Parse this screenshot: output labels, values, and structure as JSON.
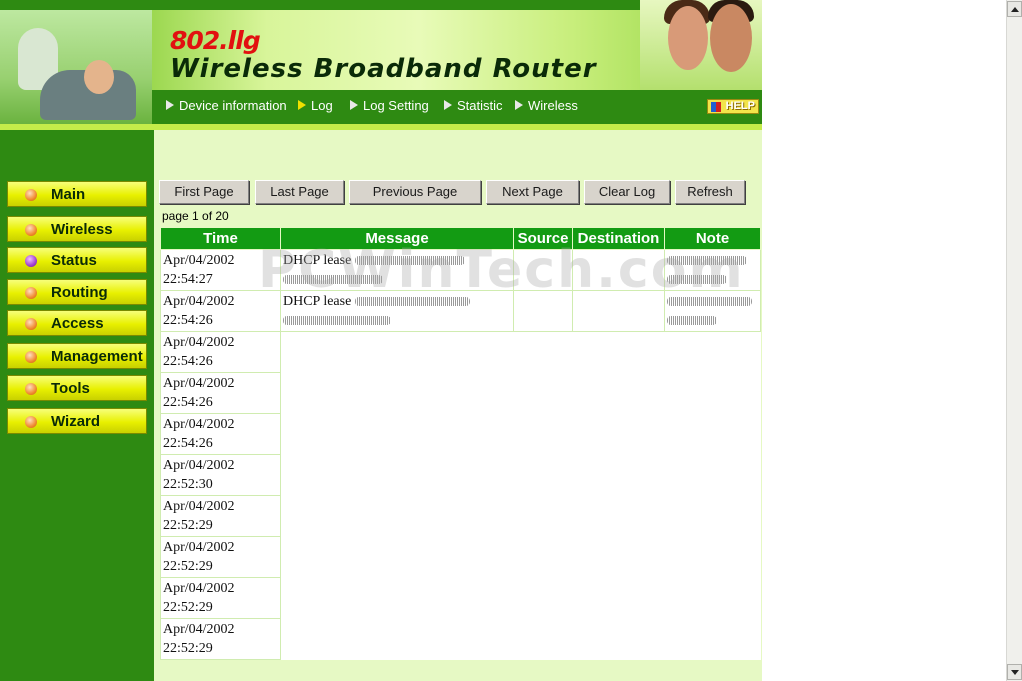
{
  "header": {
    "brand_small": "802.llg",
    "brand_big": "Wireless Broadband Router",
    "help_label": "HELP"
  },
  "topnav": {
    "items": [
      {
        "label": "Device information",
        "active": false
      },
      {
        "label": "Log",
        "active": true
      },
      {
        "label": "Log Setting",
        "active": false
      },
      {
        "label": "Statistic",
        "active": false
      },
      {
        "label": "Wireless",
        "active": false
      }
    ]
  },
  "sidebar": {
    "items": [
      {
        "label": "Main",
        "active": false
      },
      {
        "label": "Wireless",
        "active": false
      },
      {
        "label": "Status",
        "active": true
      },
      {
        "label": "Routing",
        "active": false
      },
      {
        "label": "Access",
        "active": false
      },
      {
        "label": "Management",
        "active": false
      },
      {
        "label": "Tools",
        "active": false
      },
      {
        "label": "Wizard",
        "active": false
      }
    ]
  },
  "toolbar": {
    "first_page": "First Page",
    "last_page": "Last Page",
    "previous_page": "Previous Page",
    "next_page": "Next Page",
    "clear_log": "Clear Log",
    "refresh": "Refresh"
  },
  "page_info": "page 1 of 20",
  "log_table": {
    "headers": [
      "Time",
      "Message",
      "Source",
      "Destination",
      "Note"
    ],
    "rows": [
      {
        "date": "Apr/04/2002",
        "time": "22:54:27",
        "message": "DHCP lease"
      },
      {
        "date": "Apr/04/2002",
        "time": "22:54:26",
        "message": "DHCP lease"
      },
      {
        "date": "Apr/04/2002",
        "time": "22:54:26",
        "message": ""
      },
      {
        "date": "Apr/04/2002",
        "time": "22:54:26",
        "message": ""
      },
      {
        "date": "Apr/04/2002",
        "time": "22:54:26",
        "message": ""
      },
      {
        "date": "Apr/04/2002",
        "time": "22:52:30",
        "message": ""
      },
      {
        "date": "Apr/04/2002",
        "time": "22:52:29",
        "message": ""
      },
      {
        "date": "Apr/04/2002",
        "time": "22:52:29",
        "message": ""
      },
      {
        "date": "Apr/04/2002",
        "time": "22:52:29",
        "message": ""
      },
      {
        "date": "Apr/04/2002",
        "time": "22:52:29",
        "message": ""
      }
    ]
  },
  "watermark": "PCWinTech.com"
}
